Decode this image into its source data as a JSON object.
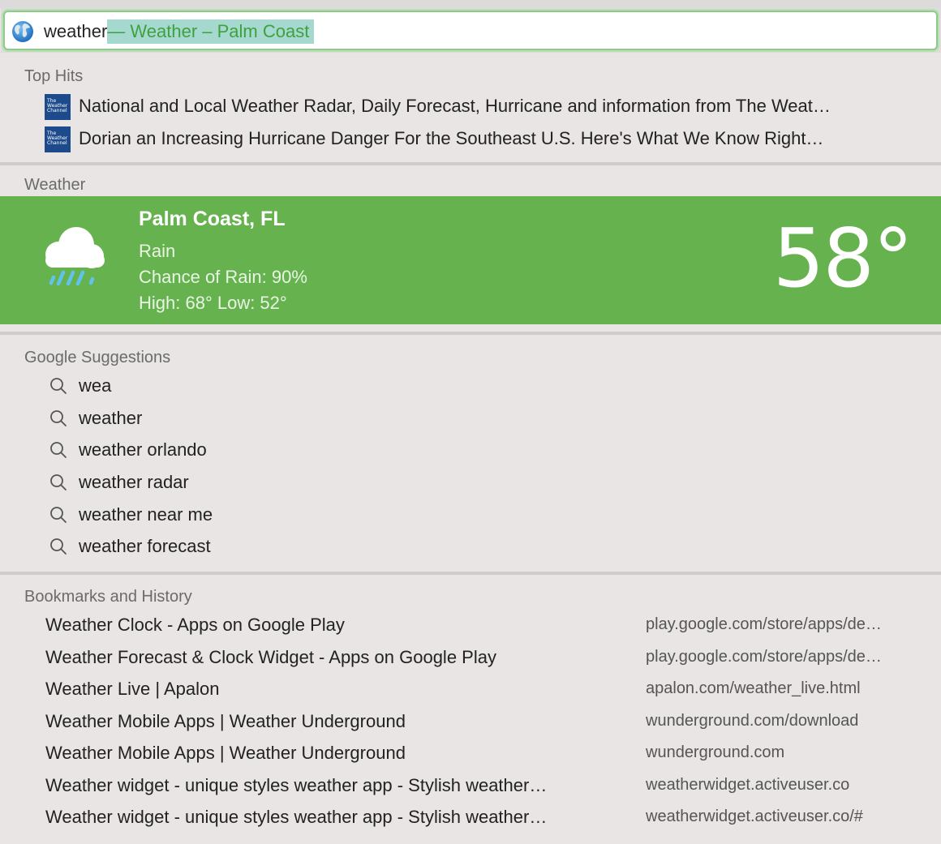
{
  "address_bar": {
    "typed_text": "weather",
    "autocomplete": " — Weather – Palm Coast"
  },
  "top_hits": {
    "title": "Top Hits",
    "items": [
      {
        "label": "National and Local Weather Radar, Daily Forecast, Hurricane and information from The Weat…",
        "icon": "weather-channel-icon",
        "icon_text": "The Weather Channel"
      },
      {
        "label": "Dorian an Increasing Hurricane Danger For the Southeast U.S. Here's What We Know Right…",
        "icon": "weather-channel-icon",
        "icon_text": "The Weather Channel"
      }
    ]
  },
  "weather": {
    "title": "Weather",
    "city": "Palm Coast, FL",
    "condition": "Rain",
    "chance": "Chance of Rain: 90%",
    "hilo": "High: 68° Low: 52°",
    "temp": "58°",
    "icon": "rain-cloud-icon",
    "bg_color": "#66b24f"
  },
  "google_suggestions": {
    "title": "Google Suggestions",
    "items": [
      {
        "label": "wea"
      },
      {
        "label": "weather"
      },
      {
        "label": "weather orlando"
      },
      {
        "label": "weather radar"
      },
      {
        "label": "weather near me"
      },
      {
        "label": "weather forecast"
      }
    ]
  },
  "bookmarks": {
    "title": "Bookmarks and History",
    "items": [
      {
        "title": "Weather Clock - Apps on Google Play",
        "url": "play.google.com/store/apps/de…"
      },
      {
        "title": "Weather Forecast & Clock Widget - Apps on Google Play",
        "url": "play.google.com/store/apps/de…"
      },
      {
        "title": "Weather Live | Apalon",
        "url": "apalon.com/weather_live.html"
      },
      {
        "title": "Weather Mobile Apps | Weather Underground",
        "url": "wunderground.com/download"
      },
      {
        "title": "Weather Mobile Apps | Weather Underground",
        "url": "wunderground.com"
      },
      {
        "title": "Weather widget - unique styles weather app - Stylish weather…",
        "url": "weatherwidget.activeuser.co"
      },
      {
        "title": "Weather widget - unique styles weather app - Stylish weather…",
        "url": "weatherwidget.activeuser.co/#"
      }
    ]
  }
}
